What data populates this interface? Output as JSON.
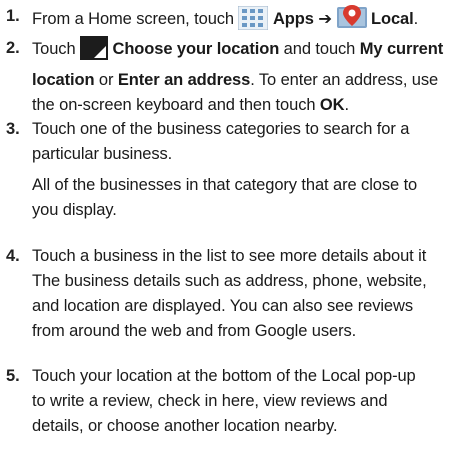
{
  "steps": [
    {
      "number": "1.",
      "lines": [
        {
          "parts": [
            "From a Home screen, touch ",
            "Apps",
            " ➔ ",
            "Local",
            "."
          ]
        }
      ],
      "icons": [
        "apps-grid-icon",
        "maps-pin-icon"
      ]
    },
    {
      "number": "2.",
      "lines": [
        {
          "parts": [
            "Touch ",
            "Choose your location",
            " and touch ",
            "My current"
          ]
        },
        {
          "parts": [
            "location",
            " or ",
            "Enter an address",
            ". To enter an address, use"
          ]
        },
        {
          "parts": [
            "the on-screen keyboard and then touch ",
            "OK",
            "."
          ]
        }
      ],
      "icons": [
        "dropdown-corner-icon"
      ]
    },
    {
      "number": "3.",
      "lines": [
        {
          "parts": [
            "Touch one of the business categories to search for a"
          ]
        },
        {
          "parts": [
            "particular business."
          ]
        }
      ],
      "extra_lines": [
        "All of the businesses in that category that are close to",
        "you display."
      ]
    },
    {
      "number": "4.",
      "lines": [
        {
          "parts": [
            "Touch a business in the list to see more details about it"
          ]
        }
      ],
      "extra_lines": [
        "The business details such as address, phone, website,",
        "and location are displayed. You can also see reviews",
        "from around the web and from Google users."
      ]
    },
    {
      "number": "5.",
      "lines": [
        {
          "parts": [
            "Touch your location at the bottom of the Local pop-up"
          ]
        },
        {
          "parts": [
            "to write a review, check in here, view reviews and"
          ]
        },
        {
          "parts": [
            "details, or choose another location nearby."
          ]
        }
      ]
    }
  ]
}
